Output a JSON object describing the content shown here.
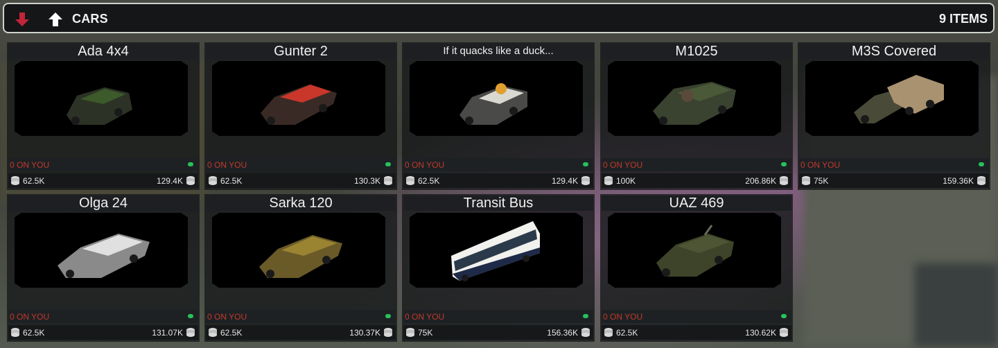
{
  "header": {
    "title": "CARS",
    "count": "9 ITEMS",
    "down_icon": "arrow-down-icon",
    "up_icon": "arrow-up-icon"
  },
  "colors": {
    "accent_red": "#c0392b",
    "status_green": "#27c25a",
    "header_border": "#cfd3d0"
  },
  "items": [
    {
      "name": "Ada 4x4",
      "on_you": "0 ON YOU",
      "buy": "62.5K",
      "sell": "129.4K",
      "body_color": "#3d5a2a"
    },
    {
      "name": "Gunter 2",
      "on_you": "0 ON YOU",
      "buy": "62.5K",
      "sell": "130.3K",
      "body_color": "#c8372a"
    },
    {
      "name": "If it quacks like a duck...",
      "on_you": "0 ON YOU",
      "buy": "62.5K",
      "sell": "129.4K",
      "body_color": "#d9d9d2"
    },
    {
      "name": "M1025",
      "on_you": "0 ON YOU",
      "buy": "100K",
      "sell": "206.86K",
      "body_color": "#4a5a38"
    },
    {
      "name": "M3S Covered",
      "on_you": "0 ON YOU",
      "buy": "75K",
      "sell": "159.36K",
      "body_color": "#a89270"
    },
    {
      "name": "Olga 24",
      "on_you": "0 ON YOU",
      "buy": "62.5K",
      "sell": "131.07K",
      "body_color": "#e0e0e0"
    },
    {
      "name": "Sarka 120",
      "on_you": "0 ON YOU",
      "buy": "62.5K",
      "sell": "130.37K",
      "body_color": "#9a8331"
    },
    {
      "name": "Transit Bus",
      "on_you": "0 ON YOU",
      "buy": "75K",
      "sell": "156.36K",
      "body_color": "#f1f1ee"
    },
    {
      "name": "UAZ 469",
      "on_you": "0 ON YOU",
      "buy": "62.5K",
      "sell": "130.62K",
      "body_color": "#4e5535"
    }
  ]
}
